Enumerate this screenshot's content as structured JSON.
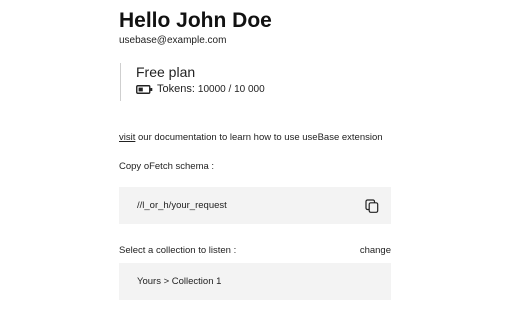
{
  "user": {
    "greeting": "Hello John Doe",
    "email": "usebase@example.com"
  },
  "plan": {
    "title": "Free plan",
    "tokens_label": "Tokens:",
    "tokens_value": "10000 / 10 000",
    "icon": "battery-icon"
  },
  "docs": {
    "link_text": "visit",
    "text": " our documentation to learn how to use useBase extension"
  },
  "schema": {
    "label": "Copy oFetch schema :",
    "value": "//l_or_h/your_request",
    "copy_icon": "copy-icon"
  },
  "collection": {
    "label": "Select a collection to listen :",
    "change_label": "change",
    "selected": "Yours > Collection 1"
  }
}
